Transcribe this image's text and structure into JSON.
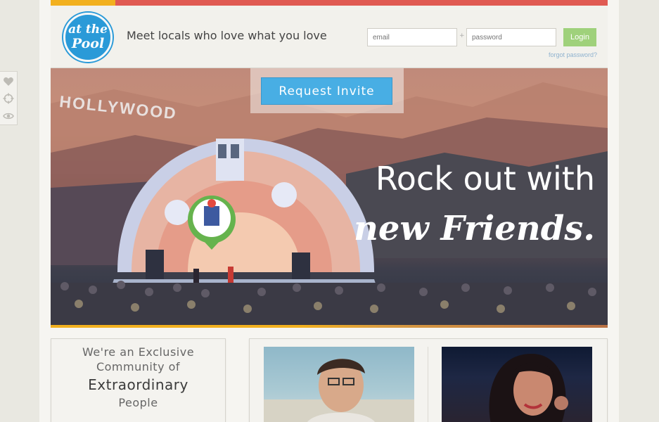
{
  "header": {
    "logo_line1": "at the",
    "logo_line2": "Pool",
    "tagline": "Meet locals who love what you love",
    "email_placeholder": "email",
    "password_placeholder": "password",
    "separator": "+",
    "login_label": "Login",
    "forgot_label": "forgot password?"
  },
  "hero": {
    "request_label": "Request Invite",
    "sign_text": "HOLLYWOOD",
    "headline_line1": "Rock out with",
    "headline_line2": "new Friends."
  },
  "toolstrip": {
    "icons": [
      "heart-icon",
      "crosshair-icon",
      "eye-icon"
    ]
  },
  "community": {
    "line1": "We're an Exclusive",
    "line2": "Community of",
    "line3": "Extraordinary",
    "line4": "People"
  },
  "colors": {
    "accent_blue": "#48aee4",
    "login_green": "#9fd17b",
    "top_red": "#e05a52",
    "top_yellow": "#f2b01e"
  }
}
